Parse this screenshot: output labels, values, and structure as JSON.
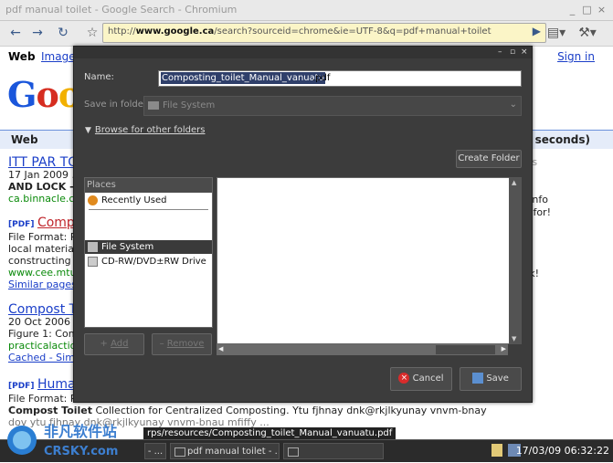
{
  "window": {
    "title": "pdf manual toilet - Google Search - Chromium",
    "controls": [
      "_",
      "□",
      "×"
    ]
  },
  "toolbar": {
    "url_prefix": "http://",
    "url_domain": "www.google.ca",
    "url_rest": "/search?sourceid=chrome&ie=UTF-8&q=pdf+manual+toilet"
  },
  "google": {
    "nav": {
      "web": "Web",
      "images": "Images",
      "signin": "Sign in"
    },
    "logo": "Goo",
    "webbar": {
      "label": "Web",
      "seconds": ".27 seconds)"
    },
    "results": [
      {
        "title": "ITT PAR TO",
        "line1": "17 Jan 2009 ...",
        "line2": "AND LOCK - M",
        "url": "ca.binnacle.co"
      },
      {
        "tag": "[PDF]",
        "title": "Compos",
        "line1": "File Format: PD",
        "line2": "local materials",
        "line3": "constructing th",
        "url": "www.cee.mtu.e",
        "similar": "Similar pages"
      },
      {
        "title": "Compost To",
        "line1": "20 Oct 2006 ...",
        "line2": "Figure 1: Comp",
        "url": "practicalaction",
        "cached": "Cached - Simil"
      },
      {
        "tag": "[PDF]",
        "title": "Humanu",
        "line1": "File Format: PD",
        "bold": "Compost Toilet",
        "line2": " Collection for Centralized Composting. Ytu fjhnay dnk@rkjlkyunay vnvm-bnay",
        "line3": "dov ytu fjhnay dnk@rkjlkyunay vnvm-bnau mfiffy ..."
      }
    ],
    "right": {
      "links": "inks",
      "al_info": "al info",
      "ng_for": "ng for!",
      "on": "on",
      "ask": "Ask!"
    }
  },
  "dialog": {
    "name_label": "Name:",
    "filename_selected": "Composting_toilet_Manual_vanuatu",
    "filename_ext": ".pdf",
    "folder_label": "Save in folder:",
    "folder_value": "File System",
    "browse_label": "Browse for other folders",
    "create_folder": "Create Folder",
    "places_header": "Places",
    "places": [
      "Recently Used",
      "File System",
      "CD-RW/DVD±RW Drive"
    ],
    "add": "Add",
    "remove": "Remove",
    "cancel": "Cancel",
    "save": "Save"
  },
  "taskbar": {
    "tooltip": "rps/resources/Composting_toilet_Manual_vanuatu.pdf",
    "task1": "pdf manual toilet - ...",
    "task2": "",
    "clock": "17/03/09 06:32:22"
  },
  "watermark": {
    "cn": "非凡软件站",
    "en": "CRSKY.com"
  },
  "colors": {
    "dialog_bg": "#3c3c3c",
    "selection": "#2f3f6a",
    "link": "#1a3ec8",
    "url_green": "#0a8a0a"
  }
}
